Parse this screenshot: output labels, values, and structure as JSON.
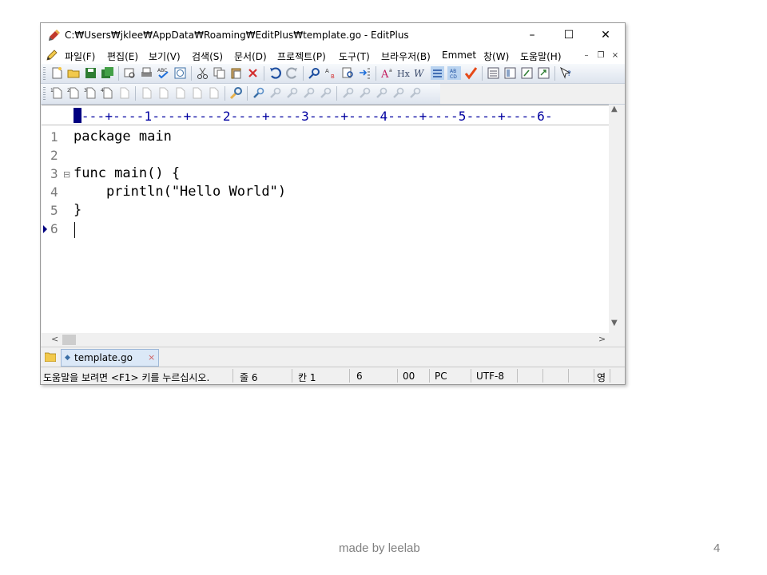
{
  "window": {
    "title": "C:₩Users₩jklee₩AppData₩Roaming₩EditPlus₩template.go - EditPlus",
    "minimize": "–",
    "maximize": "☐",
    "close": "✕"
  },
  "menu": {
    "items": [
      "파일(F)",
      "편집(E)",
      "보기(V)",
      "검색(S)",
      "문서(D)",
      "프로젝트(P)",
      "도구(T)",
      "브라우저(B)",
      "Emmet",
      "창(W)",
      "도움말(H)"
    ],
    "mdi_minimize": "–",
    "mdi_restore": "❐",
    "mdi_close": "×"
  },
  "ruler": {
    "text": "----+----1----+----2----+----3----+----4----+----5----+----6-"
  },
  "editor": {
    "line_numbers": [
      "1",
      "2",
      "3",
      "4",
      "5",
      "6"
    ],
    "lines": [
      "package main",
      "",
      "func main() {",
      "    println(\"Hello World\")",
      "}",
      ""
    ],
    "fold_mark": "⊟"
  },
  "tabs": {
    "active": "template.go",
    "close": "×"
  },
  "status": {
    "help": "도움말을 보려면 <F1> 키를 누르십시오.",
    "line": "줄 6",
    "col": "칸 1",
    "lines_total": "6",
    "code": "00",
    "eol": "PC",
    "encoding": "UTF-8",
    "ime": "영"
  },
  "footer": {
    "credit": "made by leelab",
    "page": "4"
  },
  "colors": {
    "accent": "#000080",
    "ruler_text": "#0000a0",
    "tab_bg": "#dbe8f7"
  }
}
